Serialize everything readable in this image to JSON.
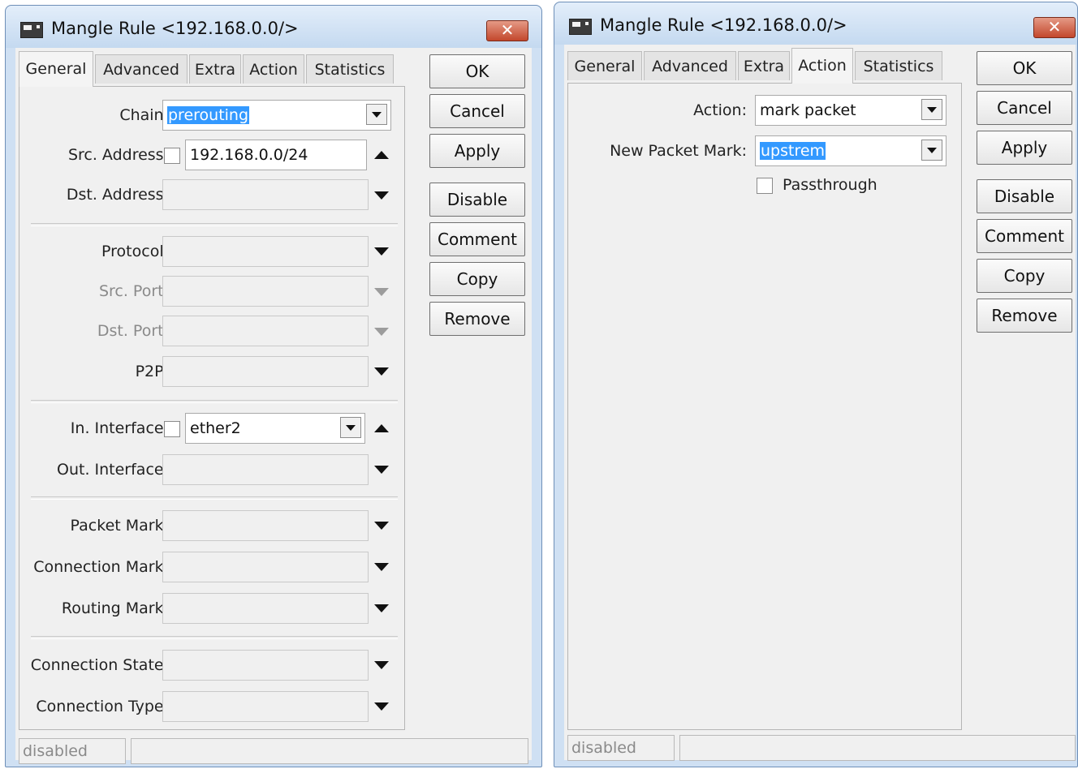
{
  "left": {
    "title": "Mangle Rule <192.168.0.0/>",
    "tabs": [
      "General",
      "Advanced",
      "Extra",
      "Action",
      "Statistics"
    ],
    "fields": {
      "chain": {
        "label": "Chain:",
        "value": "prerouting"
      },
      "src_address": {
        "label": "Src. Address:",
        "value": "192.168.0.0/24"
      },
      "dst_address": {
        "label": "Dst. Address:"
      },
      "protocol": {
        "label": "Protocol:"
      },
      "src_port": {
        "label": "Src. Port:"
      },
      "dst_port": {
        "label": "Dst. Port:"
      },
      "p2p": {
        "label": "P2P:"
      },
      "in_interface": {
        "label": "In. Interface:",
        "value": "ether2"
      },
      "out_interface": {
        "label": "Out. Interface:"
      },
      "packet_mark": {
        "label": "Packet Mark:"
      },
      "connection_mark": {
        "label": "Connection Mark:"
      },
      "routing_mark": {
        "label": "Routing Mark:"
      },
      "connection_state": {
        "label": "Connection State:"
      },
      "connection_type": {
        "label": "Connection Type:"
      }
    },
    "buttons": [
      "OK",
      "Cancel",
      "Apply",
      "Disable",
      "Comment",
      "Copy",
      "Remove"
    ],
    "status": "disabled"
  },
  "right": {
    "title": "Mangle Rule <192.168.0.0/>",
    "tabs": [
      "General",
      "Advanced",
      "Extra",
      "Action",
      "Statistics"
    ],
    "fields": {
      "action": {
        "label": "Action:",
        "value": "mark packet"
      },
      "new_packet_mark": {
        "label": "New Packet Mark:",
        "value": "upstrem"
      },
      "passthrough": {
        "label": "Passthrough"
      }
    },
    "buttons": [
      "OK",
      "Cancel",
      "Apply",
      "Disable",
      "Comment",
      "Copy",
      "Remove"
    ],
    "status": "disabled"
  },
  "colors": {
    "selection": "#3399ff",
    "frame": "#cfe0f3",
    "close": "#c3472c"
  }
}
